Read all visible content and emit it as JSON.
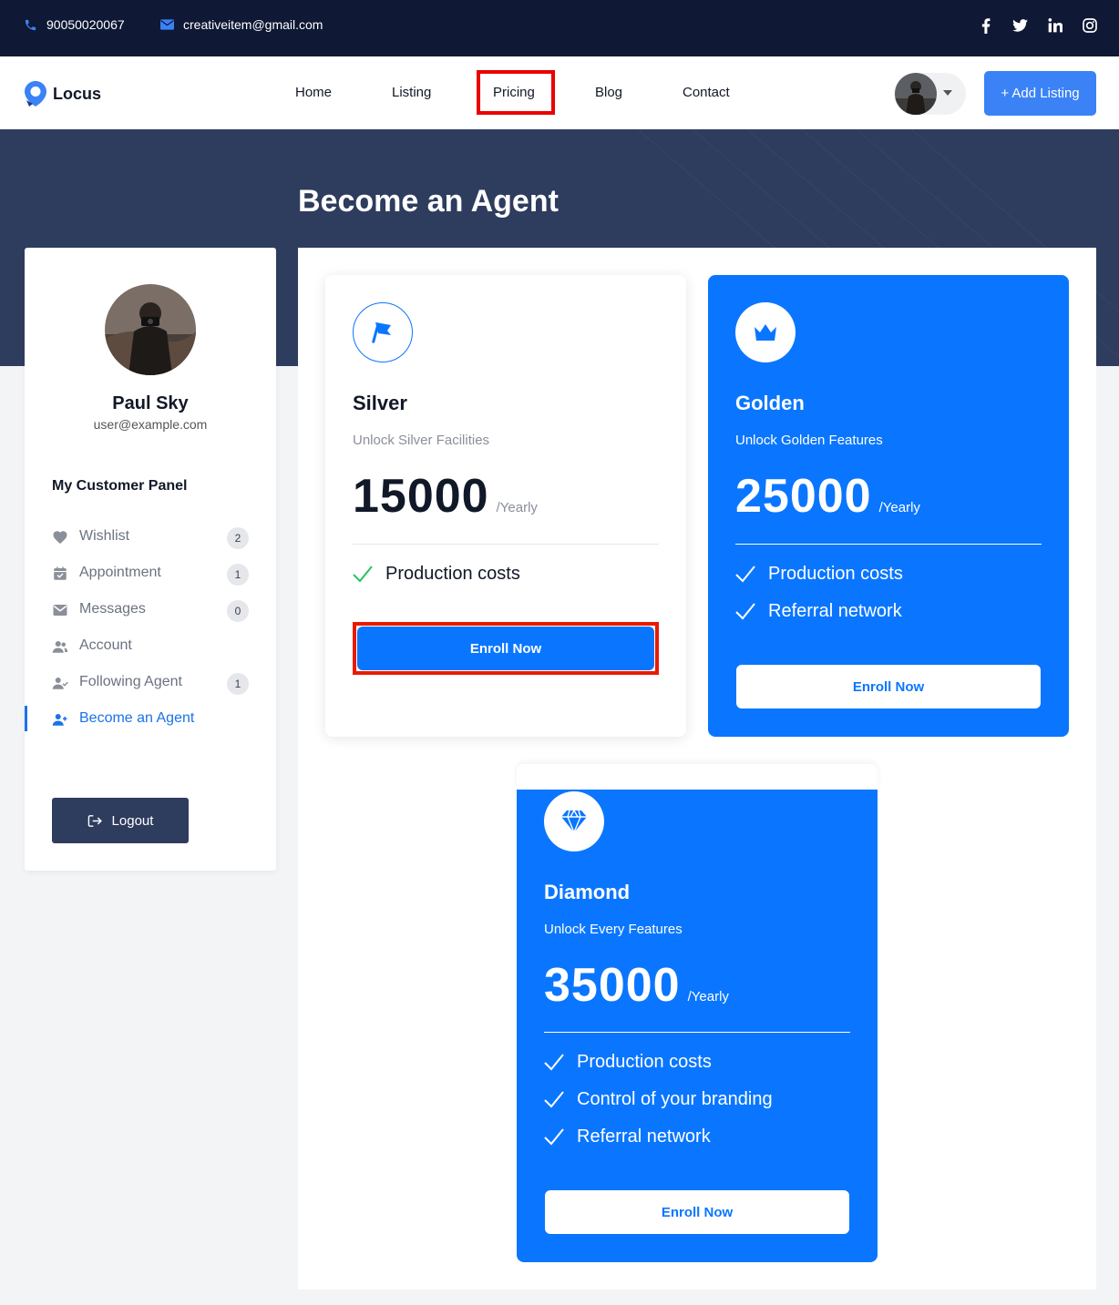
{
  "topbar": {
    "phone": "90050020067",
    "email": "creativeitem@gmail.com",
    "social": [
      "facebook-icon",
      "twitter-icon",
      "linkedin-icon",
      "instagram-icon"
    ]
  },
  "navbar": {
    "logo_text": "Locus",
    "links": [
      "Home",
      "Listing",
      "Pricing",
      "Blog",
      "Contact"
    ],
    "add_listing": "+ Add Listing"
  },
  "hero": {
    "title": "Become an Agent"
  },
  "sidebar": {
    "name": "Paul Sky",
    "email": "user@example.com",
    "panel_title": "My Customer Panel",
    "items": [
      {
        "label": "Wishlist",
        "badge": "2",
        "icon": "heart-icon"
      },
      {
        "label": "Appointment",
        "badge": "1",
        "icon": "calendar-icon"
      },
      {
        "label": "Messages",
        "badge": "0",
        "icon": "envelope-icon"
      },
      {
        "label": "Account",
        "badge": "",
        "icon": "users-icon"
      },
      {
        "label": "Following Agent",
        "badge": "1",
        "icon": "user-check-icon"
      },
      {
        "label": "Become an Agent",
        "badge": "",
        "icon": "user-plus-icon"
      }
    ],
    "logout": "Logout"
  },
  "plans": [
    {
      "name": "Silver",
      "desc": "Unlock Silver Facilities",
      "price": "15000",
      "period": "/Yearly",
      "features": [
        "Production costs"
      ],
      "button": "Enroll Now",
      "icon": "flag-icon"
    },
    {
      "name": "Golden",
      "desc": "Unlock Golden Features",
      "price": "25000",
      "period": "/Yearly",
      "features": [
        "Production costs",
        "Referral network"
      ],
      "button": "Enroll Now",
      "icon": "crown-icon"
    },
    {
      "name": "Diamond",
      "desc": "Unlock Every Features",
      "price": "35000",
      "period": "/Yearly",
      "features": [
        "Production costs",
        "Control of your branding",
        "Referral network"
      ],
      "button": "Enroll Now",
      "icon": "diamond-icon"
    }
  ],
  "colors": {
    "topbar_bg": "#0f1834",
    "hero_bg": "#2e3c5e",
    "primary": "#0a76ff",
    "highlight": "#ea0000",
    "check_green": "#22c55e"
  }
}
